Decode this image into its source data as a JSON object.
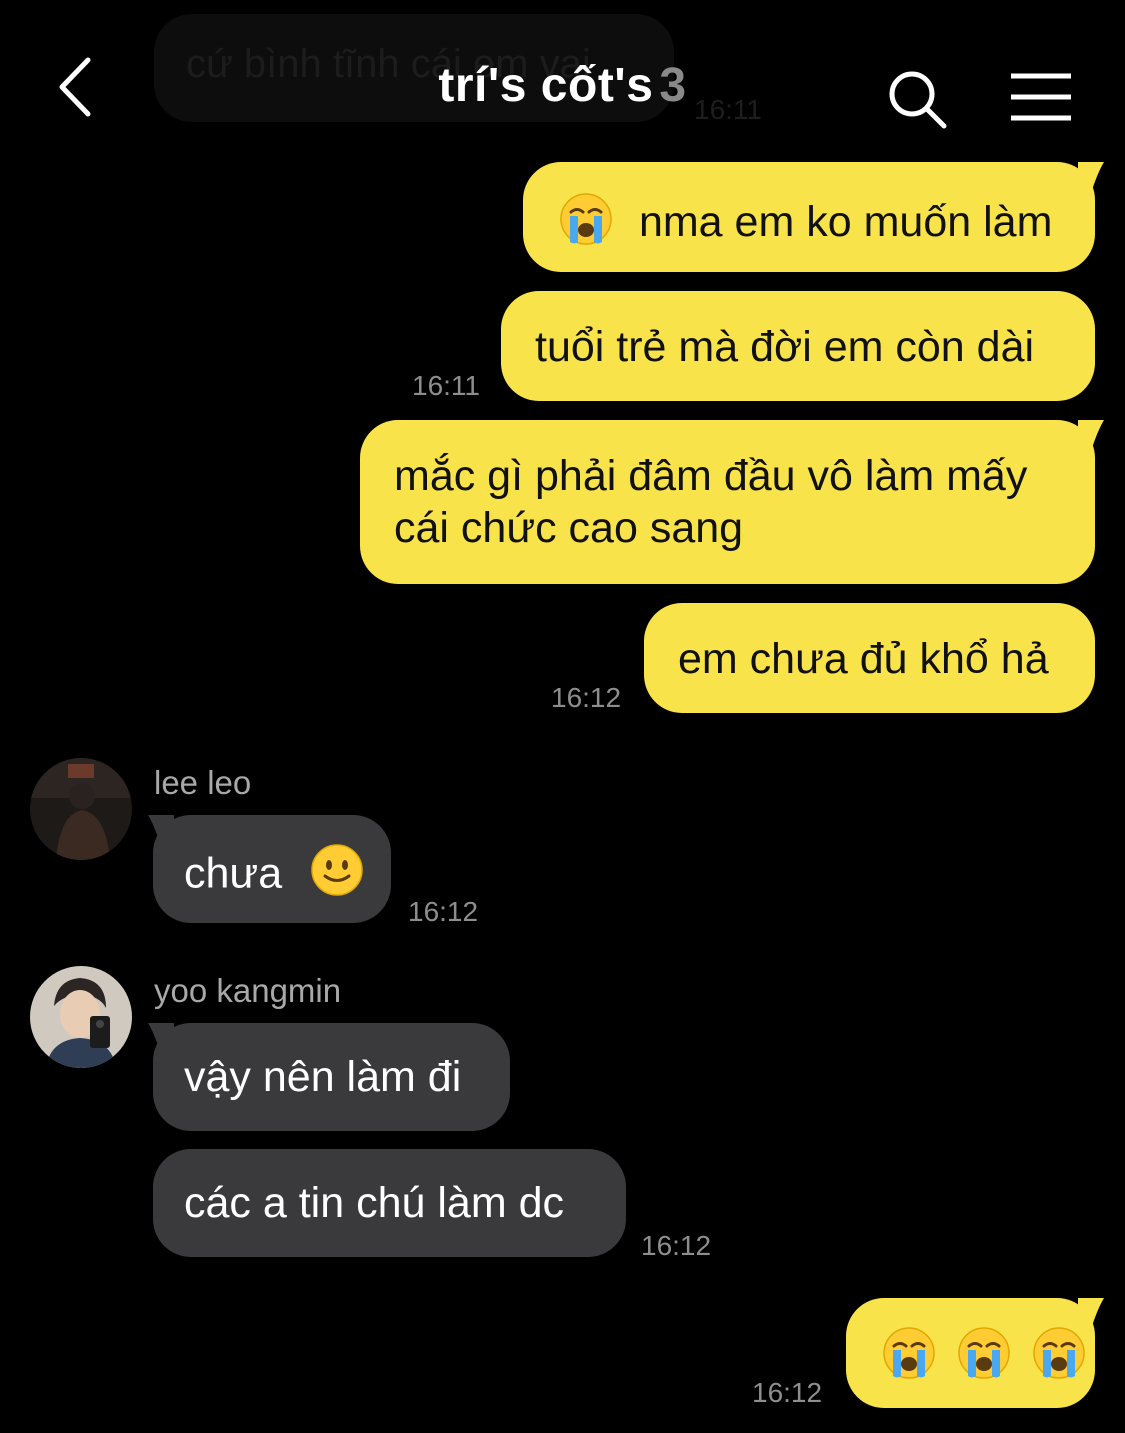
{
  "header": {
    "title": "trí's cốt's",
    "member_count": "3"
  },
  "ghost_message": {
    "text": "cứ bình tĩnh cái em vai",
    "time": "16:11"
  },
  "messages": [
    {
      "direction": "out",
      "text": "nma em ko muốn làm",
      "emoji": "loudly-crying-face"
    },
    {
      "direction": "out",
      "text": "tuổi trẻ mà đời em còn dài",
      "time": "16:11"
    },
    {
      "direction": "out",
      "line1": "mắc gì phải đâm đầu vô làm mấy",
      "line2": "cái chức cao sang"
    },
    {
      "direction": "out",
      "text": "em chưa đủ khổ hả",
      "time": "16:12"
    },
    {
      "direction": "in",
      "sender": "lee leo",
      "text": "chưa",
      "emoji": "slightly-smiling-face",
      "time": "16:12"
    },
    {
      "direction": "in",
      "sender": "yoo kangmin",
      "text": "vậy nên làm đi"
    },
    {
      "direction": "in",
      "text": "các a tin chú làm dc",
      "time": "16:12"
    },
    {
      "direction": "out",
      "emojis": [
        "loudly-crying-face",
        "loudly-crying-face",
        "loudly-crying-face"
      ],
      "time": "16:12"
    }
  ],
  "colors": {
    "background": "#000000",
    "outgoing_bubble": "#f9e34a",
    "incoming_bubble": "#3a3a3c",
    "timestamp": "#8e8e8e"
  },
  "icons": [
    "back-chevron-icon",
    "search-icon",
    "menu-icon"
  ]
}
